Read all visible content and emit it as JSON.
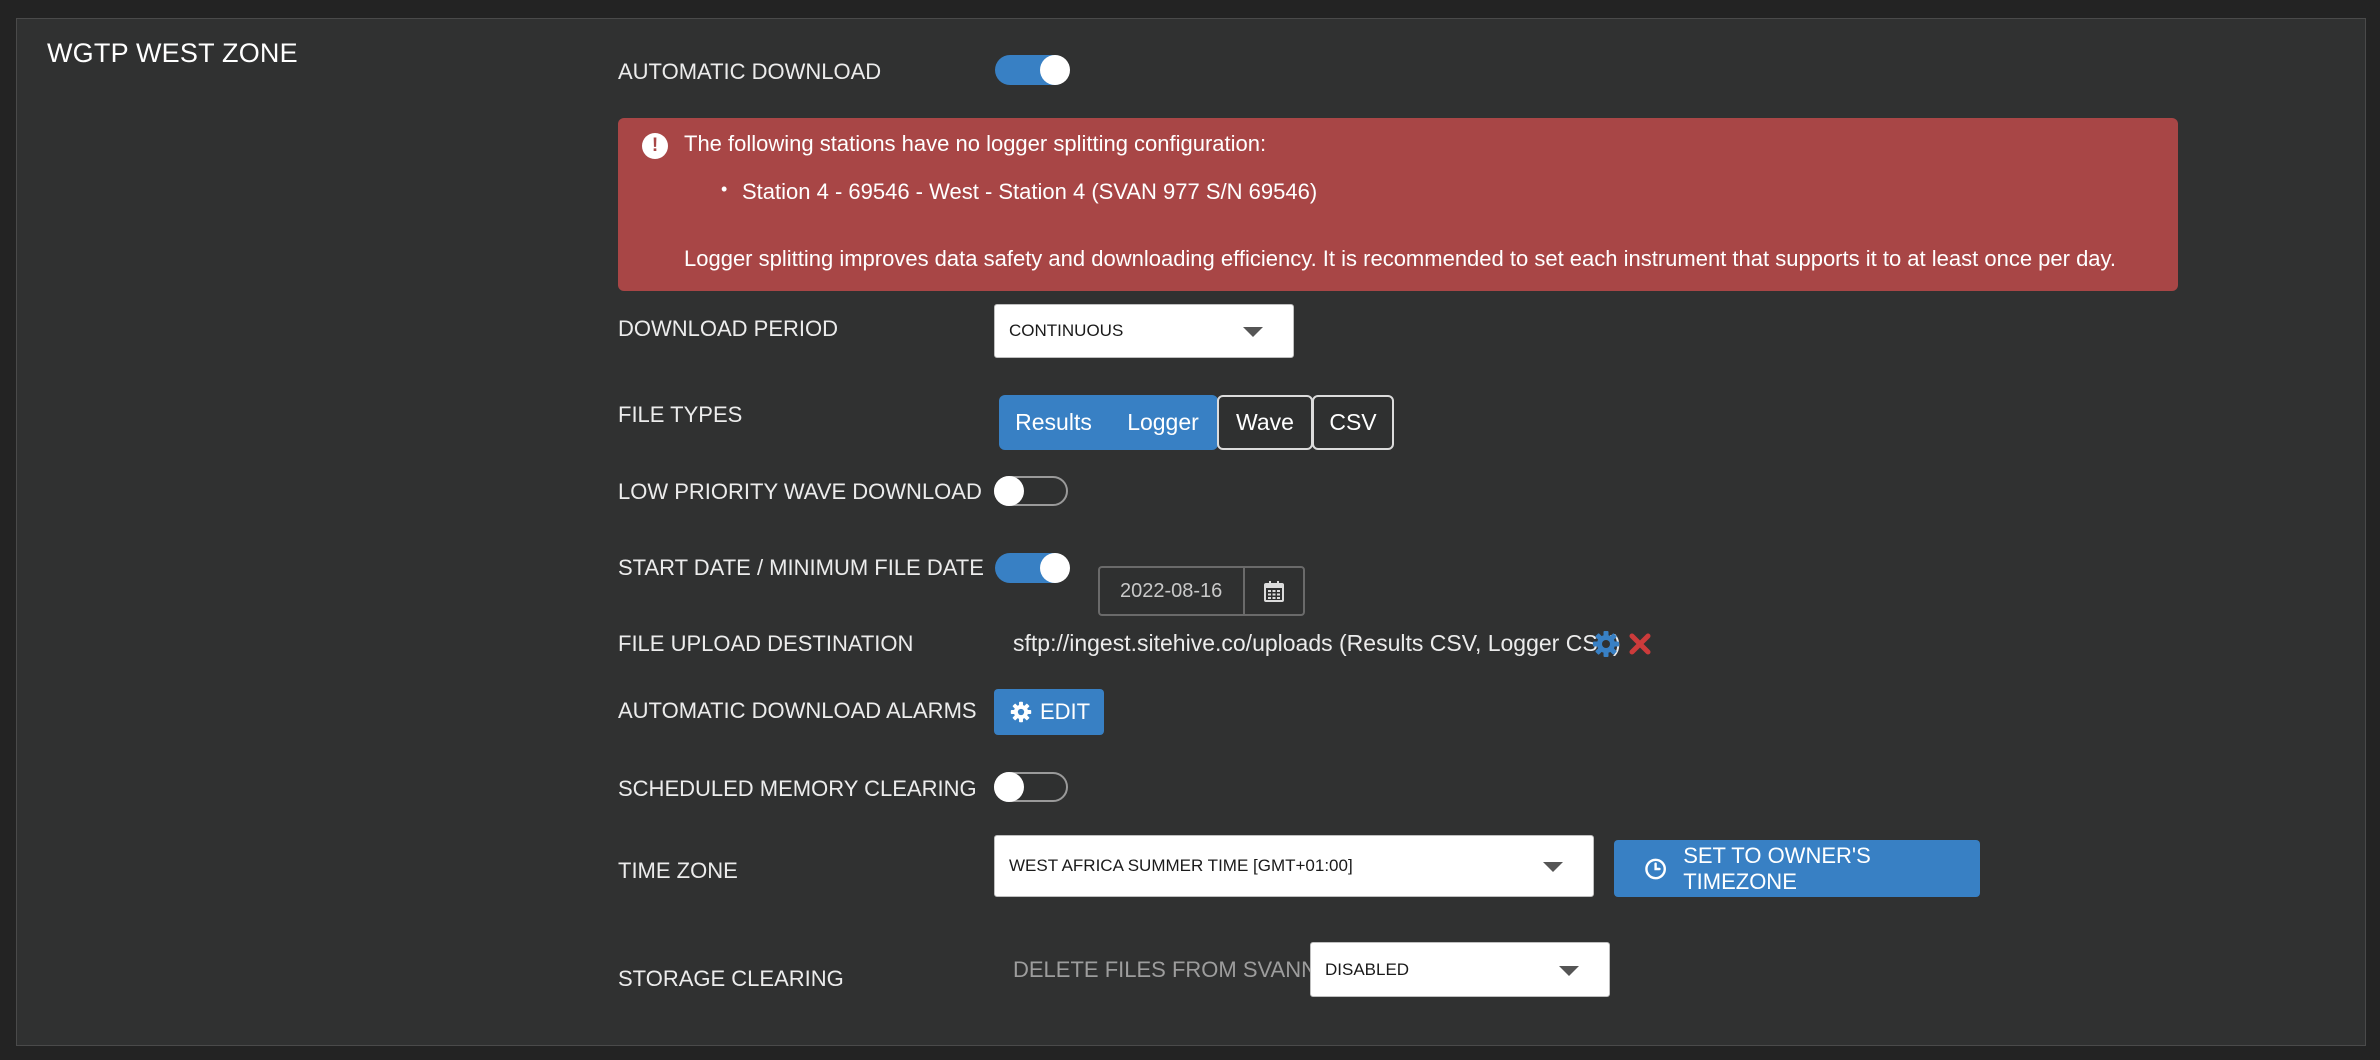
{
  "zone": {
    "title": "WGTP WEST ZONE"
  },
  "automatic_download": {
    "label": "AUTOMATIC DOWNLOAD",
    "enabled": true
  },
  "alert": {
    "title": "The following stations have no logger splitting configuration:",
    "stations": [
      "Station 4 - 69546 - West - Station 4 (SVAN 977 S/N 69546)"
    ],
    "footer": "Logger splitting improves data safety and downloading efficiency. It is recommended to set each instrument that supports it to at least once per day.",
    "color": "#a84646"
  },
  "download_period": {
    "label": "DOWNLOAD PERIOD",
    "value": "CONTINUOUS"
  },
  "file_types": {
    "label": "FILE TYPES",
    "options": [
      {
        "label": "Results",
        "active": true
      },
      {
        "label": "Logger",
        "active": true
      },
      {
        "label": "Wave",
        "active": false
      },
      {
        "label": "CSV",
        "active": false
      }
    ]
  },
  "low_priority_wave": {
    "label": "LOW PRIORITY WAVE DOWNLOAD",
    "enabled": false
  },
  "start_date": {
    "label": "START DATE / MINIMUM FILE DATE",
    "enabled": true,
    "value": "2022-08-16"
  },
  "file_upload": {
    "label": "FILE UPLOAD DESTINATION",
    "value": "sftp://ingest.sitehive.co/uploads (Results CSV, Logger CSV)"
  },
  "alarms": {
    "label": "AUTOMATIC DOWNLOAD ALARMS",
    "button": "EDIT"
  },
  "memory_clearing": {
    "label": "SCHEDULED MEMORY CLEARING",
    "enabled": false
  },
  "time_zone": {
    "label": "TIME ZONE",
    "value": "WEST AFRICA SUMMER TIME [GMT+01:00]",
    "button": "SET TO OWNER'S TIMEZONE"
  },
  "storage_clearing": {
    "label": "STORAGE CLEARING",
    "sub_label": "DELETE FILES FROM SVANNET",
    "value": "DISABLED"
  },
  "colors": {
    "accent": "#3880c4",
    "danger": "#cc3b3b",
    "panel": "#303131",
    "background": "#232323"
  }
}
